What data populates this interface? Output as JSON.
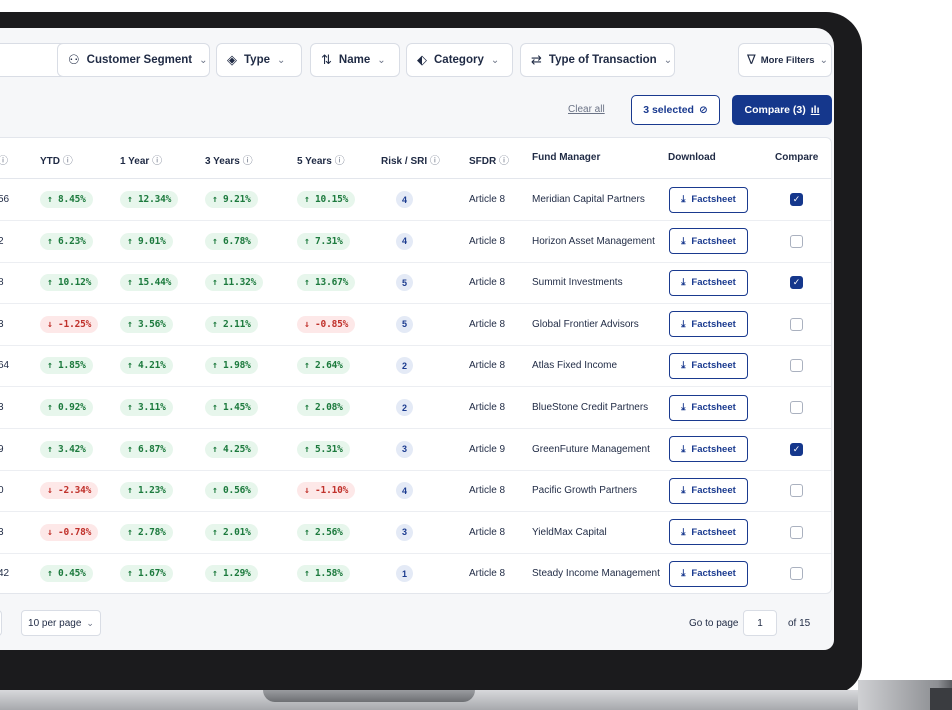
{
  "filters": [
    {
      "label": "Customer Segment",
      "icon": "users-icon",
      "glyph": "⚇"
    },
    {
      "label": "Type",
      "icon": "layers-icon",
      "glyph": "◈"
    },
    {
      "label": "Name",
      "icon": "sort-az-icon",
      "glyph": "⇅"
    },
    {
      "label": "Category",
      "icon": "tag-icon",
      "glyph": "⬖"
    },
    {
      "label": "Type of Transaction",
      "icon": "transfer-icon",
      "glyph": "⇄"
    },
    {
      "label": "More Filters",
      "icon": "filter-icon",
      "glyph": "∇"
    }
  ],
  "actions": {
    "clear_all": "Clear all",
    "selected": "3 selected",
    "compare": "Compare (3)"
  },
  "columns": {
    "first_partial": "ⓘ",
    "ytd": "YTD",
    "one_year": "1 Year",
    "three_years": "3 Years",
    "five_years": "5 Years",
    "risk": "Risk / SRI",
    "sfdr": "SFDR",
    "fund_manager": "Fund Manager",
    "download": "Download",
    "compare": "Compare",
    "info_glyph": "ⓘ"
  },
  "download_label": "Factsheet",
  "rows": [
    {
      "first": "56",
      "ytd": "↑ 8.45%",
      "ytd_dir": "pos",
      "y1": "↑ 12.34%",
      "y1_dir": "pos",
      "y3": "↑ 9.21%",
      "y3_dir": "pos",
      "y5": "↑ 10.15%",
      "y5_dir": "pos",
      "risk": "4",
      "sfdr": "Article 8",
      "manager": "Meridian Capital Partners",
      "checked": true
    },
    {
      "first": "2",
      "ytd": "↑ 6.23%",
      "ytd_dir": "pos",
      "y1": "↑ 9.01%",
      "y1_dir": "pos",
      "y3": "↑ 6.78%",
      "y3_dir": "pos",
      "y5": "↑ 7.31%",
      "y5_dir": "pos",
      "risk": "4",
      "sfdr": "Article 8",
      "manager": "Horizon Asset Management",
      "checked": false
    },
    {
      "first": "8",
      "ytd": "↑ 10.12%",
      "ytd_dir": "pos",
      "y1": "↑ 15.44%",
      "y1_dir": "pos",
      "y3": "↑ 11.32%",
      "y3_dir": "pos",
      "y5": "↑ 13.67%",
      "y5_dir": "pos",
      "risk": "5",
      "sfdr": "Article 8",
      "manager": "Summit Investments",
      "checked": true
    },
    {
      "first": "3",
      "ytd": "↓ -1.25%",
      "ytd_dir": "neg",
      "y1": "↑ 3.56%",
      "y1_dir": "pos",
      "y3": "↑ 2.11%",
      "y3_dir": "pos",
      "y5": "↓ -0.85%",
      "y5_dir": "neg",
      "risk": "5",
      "sfdr": "Article 8",
      "manager": "Global Frontier Advisors",
      "checked": false
    },
    {
      "first": "64",
      "ytd": "↑ 1.85%",
      "ytd_dir": "pos",
      "y1": "↑ 4.21%",
      "y1_dir": "pos",
      "y3": "↑ 1.98%",
      "y3_dir": "pos",
      "y5": "↑ 2.64%",
      "y5_dir": "pos",
      "risk": "2",
      "sfdr": "Article 8",
      "manager": "Atlas Fixed Income",
      "checked": false
    },
    {
      "first": "3",
      "ytd": "↑ 0.92%",
      "ytd_dir": "pos",
      "y1": "↑ 3.11%",
      "y1_dir": "pos",
      "y3": "↑ 1.45%",
      "y3_dir": "pos",
      "y5": "↑ 2.08%",
      "y5_dir": "pos",
      "risk": "2",
      "sfdr": "Article 8",
      "manager": "BlueStone Credit Partners",
      "checked": false
    },
    {
      "first": "9",
      "ytd": "↑ 3.42%",
      "ytd_dir": "pos",
      "y1": "↑ 6.87%",
      "y1_dir": "pos",
      "y3": "↑ 4.25%",
      "y3_dir": "pos",
      "y5": "↑ 5.31%",
      "y5_dir": "pos",
      "risk": "3",
      "sfdr": "Article 9",
      "manager": "GreenFuture Management",
      "checked": true
    },
    {
      "first": "0",
      "ytd": "↓ -2.34%",
      "ytd_dir": "neg",
      "y1": "↑ 1.23%",
      "y1_dir": "pos",
      "y3": "↑ 0.56%",
      "y3_dir": "pos",
      "y5": "↓ -1.10%",
      "y5_dir": "neg",
      "risk": "4",
      "sfdr": "Article 8",
      "manager": "Pacific Growth Partners",
      "checked": false
    },
    {
      "first": "3",
      "ytd": "↓ -0.78%",
      "ytd_dir": "neg",
      "y1": "↑ 2.78%",
      "y1_dir": "pos",
      "y3": "↑ 2.01%",
      "y3_dir": "pos",
      "y5": "↑ 2.56%",
      "y5_dir": "pos",
      "risk": "3",
      "sfdr": "Article 8",
      "manager": "YieldMax Capital",
      "checked": false
    },
    {
      "first": "42",
      "ytd": "↑ 0.45%",
      "ytd_dir": "pos",
      "y1": "↑ 1.67%",
      "y1_dir": "pos",
      "y3": "↑ 1.29%",
      "y3_dir": "pos",
      "y5": "↑ 1.58%",
      "y5_dir": "pos",
      "risk": "1",
      "sfdr": "Article 8",
      "manager": "Steady Income Management",
      "checked": false
    }
  ],
  "pagination": {
    "per_page": "10 per page",
    "go_to": "Go to page",
    "current": "1",
    "of_total": "of 15"
  },
  "colors": {
    "primary": "#15378c",
    "positive_bg": "#e7f6ec",
    "positive_fg": "#1c7a3d",
    "negative_bg": "#fde8e8",
    "negative_fg": "#c0312b"
  }
}
